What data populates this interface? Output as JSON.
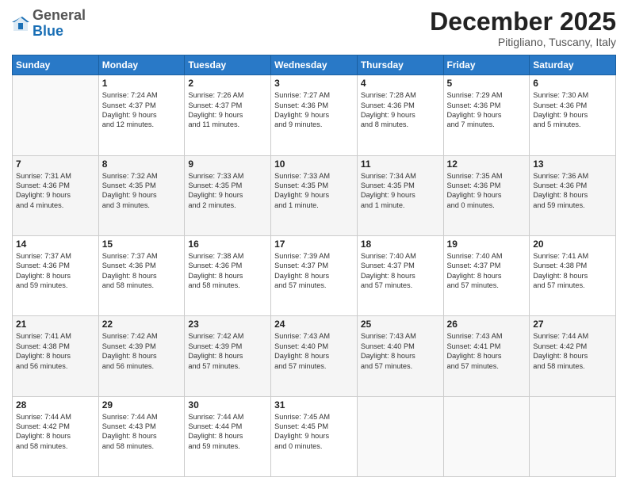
{
  "header": {
    "logo_general": "General",
    "logo_blue": "Blue",
    "month": "December 2025",
    "location": "Pitigliano, Tuscany, Italy"
  },
  "days_of_week": [
    "Sunday",
    "Monday",
    "Tuesday",
    "Wednesday",
    "Thursday",
    "Friday",
    "Saturday"
  ],
  "weeks": [
    [
      {
        "day": "",
        "lines": []
      },
      {
        "day": "1",
        "lines": [
          "Sunrise: 7:24 AM",
          "Sunset: 4:37 PM",
          "Daylight: 9 hours",
          "and 12 minutes."
        ]
      },
      {
        "day": "2",
        "lines": [
          "Sunrise: 7:26 AM",
          "Sunset: 4:37 PM",
          "Daylight: 9 hours",
          "and 11 minutes."
        ]
      },
      {
        "day": "3",
        "lines": [
          "Sunrise: 7:27 AM",
          "Sunset: 4:36 PM",
          "Daylight: 9 hours",
          "and 9 minutes."
        ]
      },
      {
        "day": "4",
        "lines": [
          "Sunrise: 7:28 AM",
          "Sunset: 4:36 PM",
          "Daylight: 9 hours",
          "and 8 minutes."
        ]
      },
      {
        "day": "5",
        "lines": [
          "Sunrise: 7:29 AM",
          "Sunset: 4:36 PM",
          "Daylight: 9 hours",
          "and 7 minutes."
        ]
      },
      {
        "day": "6",
        "lines": [
          "Sunrise: 7:30 AM",
          "Sunset: 4:36 PM",
          "Daylight: 9 hours",
          "and 5 minutes."
        ]
      }
    ],
    [
      {
        "day": "7",
        "lines": [
          "Sunrise: 7:31 AM",
          "Sunset: 4:36 PM",
          "Daylight: 9 hours",
          "and 4 minutes."
        ]
      },
      {
        "day": "8",
        "lines": [
          "Sunrise: 7:32 AM",
          "Sunset: 4:35 PM",
          "Daylight: 9 hours",
          "and 3 minutes."
        ]
      },
      {
        "day": "9",
        "lines": [
          "Sunrise: 7:33 AM",
          "Sunset: 4:35 PM",
          "Daylight: 9 hours",
          "and 2 minutes."
        ]
      },
      {
        "day": "10",
        "lines": [
          "Sunrise: 7:33 AM",
          "Sunset: 4:35 PM",
          "Daylight: 9 hours",
          "and 1 minute."
        ]
      },
      {
        "day": "11",
        "lines": [
          "Sunrise: 7:34 AM",
          "Sunset: 4:35 PM",
          "Daylight: 9 hours",
          "and 1 minute."
        ]
      },
      {
        "day": "12",
        "lines": [
          "Sunrise: 7:35 AM",
          "Sunset: 4:36 PM",
          "Daylight: 9 hours",
          "and 0 minutes."
        ]
      },
      {
        "day": "13",
        "lines": [
          "Sunrise: 7:36 AM",
          "Sunset: 4:36 PM",
          "Daylight: 8 hours",
          "and 59 minutes."
        ]
      }
    ],
    [
      {
        "day": "14",
        "lines": [
          "Sunrise: 7:37 AM",
          "Sunset: 4:36 PM",
          "Daylight: 8 hours",
          "and 59 minutes."
        ]
      },
      {
        "day": "15",
        "lines": [
          "Sunrise: 7:37 AM",
          "Sunset: 4:36 PM",
          "Daylight: 8 hours",
          "and 58 minutes."
        ]
      },
      {
        "day": "16",
        "lines": [
          "Sunrise: 7:38 AM",
          "Sunset: 4:36 PM",
          "Daylight: 8 hours",
          "and 58 minutes."
        ]
      },
      {
        "day": "17",
        "lines": [
          "Sunrise: 7:39 AM",
          "Sunset: 4:37 PM",
          "Daylight: 8 hours",
          "and 57 minutes."
        ]
      },
      {
        "day": "18",
        "lines": [
          "Sunrise: 7:40 AM",
          "Sunset: 4:37 PM",
          "Daylight: 8 hours",
          "and 57 minutes."
        ]
      },
      {
        "day": "19",
        "lines": [
          "Sunrise: 7:40 AM",
          "Sunset: 4:37 PM",
          "Daylight: 8 hours",
          "and 57 minutes."
        ]
      },
      {
        "day": "20",
        "lines": [
          "Sunrise: 7:41 AM",
          "Sunset: 4:38 PM",
          "Daylight: 8 hours",
          "and 57 minutes."
        ]
      }
    ],
    [
      {
        "day": "21",
        "lines": [
          "Sunrise: 7:41 AM",
          "Sunset: 4:38 PM",
          "Daylight: 8 hours",
          "and 56 minutes."
        ]
      },
      {
        "day": "22",
        "lines": [
          "Sunrise: 7:42 AM",
          "Sunset: 4:39 PM",
          "Daylight: 8 hours",
          "and 56 minutes."
        ]
      },
      {
        "day": "23",
        "lines": [
          "Sunrise: 7:42 AM",
          "Sunset: 4:39 PM",
          "Daylight: 8 hours",
          "and 57 minutes."
        ]
      },
      {
        "day": "24",
        "lines": [
          "Sunrise: 7:43 AM",
          "Sunset: 4:40 PM",
          "Daylight: 8 hours",
          "and 57 minutes."
        ]
      },
      {
        "day": "25",
        "lines": [
          "Sunrise: 7:43 AM",
          "Sunset: 4:40 PM",
          "Daylight: 8 hours",
          "and 57 minutes."
        ]
      },
      {
        "day": "26",
        "lines": [
          "Sunrise: 7:43 AM",
          "Sunset: 4:41 PM",
          "Daylight: 8 hours",
          "and 57 minutes."
        ]
      },
      {
        "day": "27",
        "lines": [
          "Sunrise: 7:44 AM",
          "Sunset: 4:42 PM",
          "Daylight: 8 hours",
          "and 58 minutes."
        ]
      }
    ],
    [
      {
        "day": "28",
        "lines": [
          "Sunrise: 7:44 AM",
          "Sunset: 4:42 PM",
          "Daylight: 8 hours",
          "and 58 minutes."
        ]
      },
      {
        "day": "29",
        "lines": [
          "Sunrise: 7:44 AM",
          "Sunset: 4:43 PM",
          "Daylight: 8 hours",
          "and 58 minutes."
        ]
      },
      {
        "day": "30",
        "lines": [
          "Sunrise: 7:44 AM",
          "Sunset: 4:44 PM",
          "Daylight: 8 hours",
          "and 59 minutes."
        ]
      },
      {
        "day": "31",
        "lines": [
          "Sunrise: 7:45 AM",
          "Sunset: 4:45 PM",
          "Daylight: 9 hours",
          "and 0 minutes."
        ]
      },
      {
        "day": "",
        "lines": []
      },
      {
        "day": "",
        "lines": []
      },
      {
        "day": "",
        "lines": []
      }
    ]
  ]
}
